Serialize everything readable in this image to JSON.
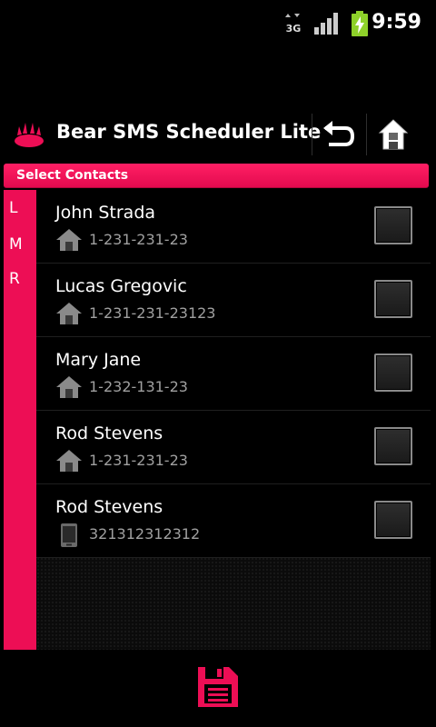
{
  "status_bar": {
    "time": "9:59",
    "network_icon": "3g-icon",
    "signal_icon": "signal-icon",
    "battery_icon": "battery-charging-icon"
  },
  "action_bar": {
    "title": "Bear SMS Scheduler Lite",
    "logo_icon": "bear-paw-icon",
    "back_icon": "undo-icon",
    "home_icon": "home-icon"
  },
  "section": {
    "title": "Select Contacts"
  },
  "alpha_index": [
    "L",
    "M",
    "R"
  ],
  "contacts": [
    {
      "name": "John Strada",
      "number": "1-231-231-23",
      "type_icon": "home-icon",
      "checked": false
    },
    {
      "name": "Lucas Gregovic",
      "number": "1-231-231-23123",
      "type_icon": "home-icon",
      "checked": false
    },
    {
      "name": "Mary Jane",
      "number": "1-232-131-23",
      "type_icon": "home-icon",
      "checked": false
    },
    {
      "name": "Rod Stevens",
      "number": "1-231-231-23",
      "type_icon": "home-icon",
      "checked": false
    },
    {
      "name": "Rod Stevens",
      "number": "321312312312",
      "type_icon": "mobile-phone-icon",
      "checked": false
    }
  ],
  "footer": {
    "save_icon": "save-icon"
  },
  "colors": {
    "accent": "#ed0e55",
    "background": "#000000",
    "secondary_text": "#a0a0a0"
  }
}
